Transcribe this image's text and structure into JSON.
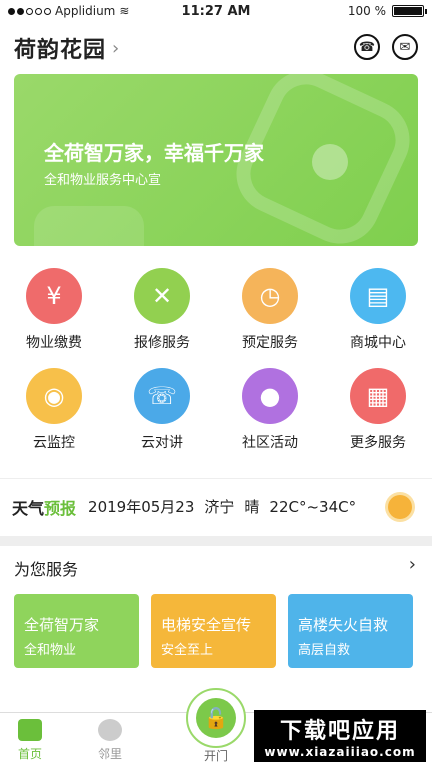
{
  "status": {
    "carrier": "Applidium",
    "time": "11:27 AM",
    "battery": "100 %"
  },
  "header": {
    "title": "荷韵花园"
  },
  "banner": {
    "title": "全荷智万家，幸福千万家",
    "subtitle": "全和物业服务中心宣"
  },
  "grid": [
    {
      "label": "物业缴费",
      "color": "#ef6b6b",
      "icon": "money-hand-icon",
      "glyph": "¥"
    },
    {
      "label": "报修服务",
      "color": "#92d050",
      "icon": "tools-icon",
      "glyph": "✕"
    },
    {
      "label": "预定服务",
      "color": "#f5b45a",
      "icon": "clock-icon",
      "glyph": "◷"
    },
    {
      "label": "商城中心",
      "color": "#4db8f0",
      "icon": "store-icon",
      "glyph": "▤"
    },
    {
      "label": "云监控",
      "color": "#f7c04a",
      "icon": "camera-icon",
      "glyph": "◉"
    },
    {
      "label": "云对讲",
      "color": "#4ba9e8",
      "icon": "intercom-icon",
      "glyph": "☏"
    },
    {
      "label": "社区活动",
      "color": "#b071e0",
      "icon": "ball-icon",
      "glyph": "●"
    },
    {
      "label": "更多服务",
      "color": "#f06a6a",
      "icon": "grid-icon",
      "glyph": "▦"
    }
  ],
  "weather": {
    "tag_a": "天气",
    "tag_b": "预报",
    "date": "2019年05月23",
    "city": "济宁",
    "condition": "晴",
    "temp": "22C°~34C°"
  },
  "services": {
    "title": "为您服务",
    "cards": [
      {
        "title": "全荷智万家",
        "sub": "全和物业",
        "color": "#8fd45c"
      },
      {
        "title": "电梯安全宣传",
        "sub": "安全至上",
        "color": "#f5b73a"
      },
      {
        "title": "高楼失火自救",
        "sub": "高层自救",
        "color": "#4fb4ea"
      }
    ]
  },
  "tabs": {
    "home": "首页",
    "neighbors": "邻里",
    "open": "开门"
  },
  "watermark": {
    "line1": "下载吧应用",
    "line2": "www.xiazaiiiao.com"
  }
}
